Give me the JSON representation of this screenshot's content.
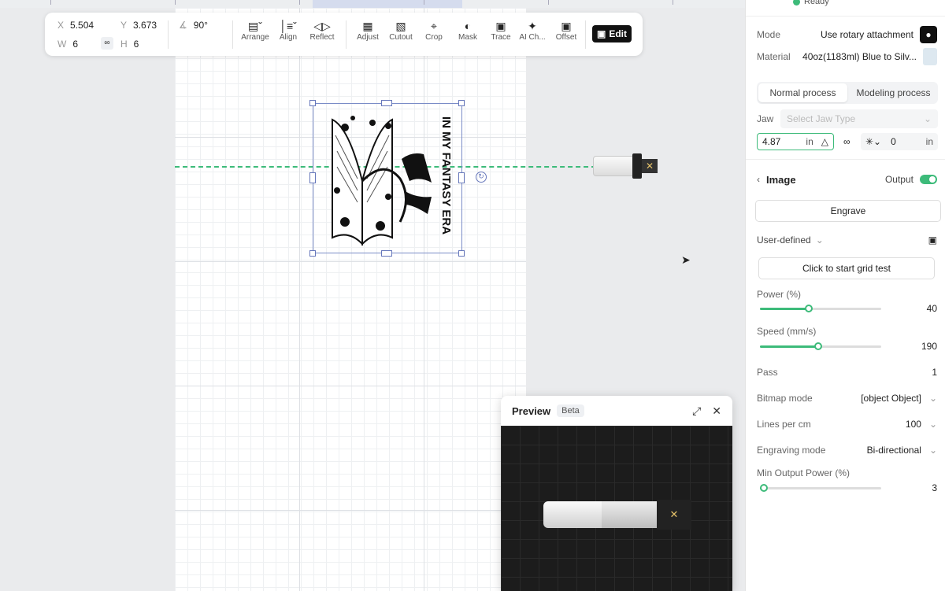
{
  "status": {
    "text": "Ready",
    "color": "#3dbb7a"
  },
  "toolbar": {
    "x_label": "X",
    "x_value": "5.504",
    "y_label": "Y",
    "y_value": "3.673",
    "w_label": "W",
    "w_value": "6",
    "h_label": "H",
    "h_value": "6",
    "rotation": "90°",
    "tools": [
      {
        "label": "Arrange",
        "icon": "arrange-icon"
      },
      {
        "label": "Align",
        "icon": "align-icon"
      },
      {
        "label": "Reflect",
        "icon": "reflect-icon"
      },
      {
        "label": "Adjust",
        "icon": "adjust-icon"
      },
      {
        "label": "Cutout",
        "icon": "cutout-icon"
      },
      {
        "label": "Crop",
        "icon": "crop-icon"
      },
      {
        "label": "Mask",
        "icon": "mask-icon"
      },
      {
        "label": "Trace",
        "icon": "trace-icon"
      },
      {
        "label": "AI Ch...",
        "icon": "ai-sparkle-icon"
      },
      {
        "label": "Offset",
        "icon": "offset-icon"
      }
    ],
    "edit_label": "Edit"
  },
  "design": {
    "text": "IN MY FANTASY ERA"
  },
  "preview": {
    "title": "Preview",
    "badge": "Beta"
  },
  "panel": {
    "mode_label": "Mode",
    "mode_value": "Use rotary attachment",
    "material_label": "Material",
    "material_value": "40oz(1183ml) Blue to Silv...",
    "process_tabs": [
      "Normal process",
      "Modeling process"
    ],
    "jaw_label": "Jaw",
    "jaw_placeholder": "Select Jaw Type",
    "diameter_value": "4.87",
    "diameter_unit": "in",
    "offset_value": "0",
    "offset_unit": "in",
    "section_title": "Image",
    "output_label": "Output",
    "output_on": true,
    "engrave_label": "Engrave",
    "preset_label": "User-defined",
    "grid_test_label": "Click to start grid test",
    "power_label": "Power (%)",
    "power_value": "40",
    "power_fraction": 0.4,
    "speed_label": "Speed (mm/s)",
    "speed_value": "190",
    "speed_fraction": 0.48,
    "pass_label": "Pass",
    "pass_value": "1",
    "bitmap_label": "Bitmap mode",
    "bitmap_value": "[object Object]",
    "lines_label": "Lines per cm",
    "lines_value": "100",
    "engrave_mode_label": "Engraving mode",
    "engrave_mode_value": "Bi-directional",
    "min_power_label": "Min Output Power (%)",
    "min_power_value": "3",
    "min_power_fraction": 0.03
  }
}
